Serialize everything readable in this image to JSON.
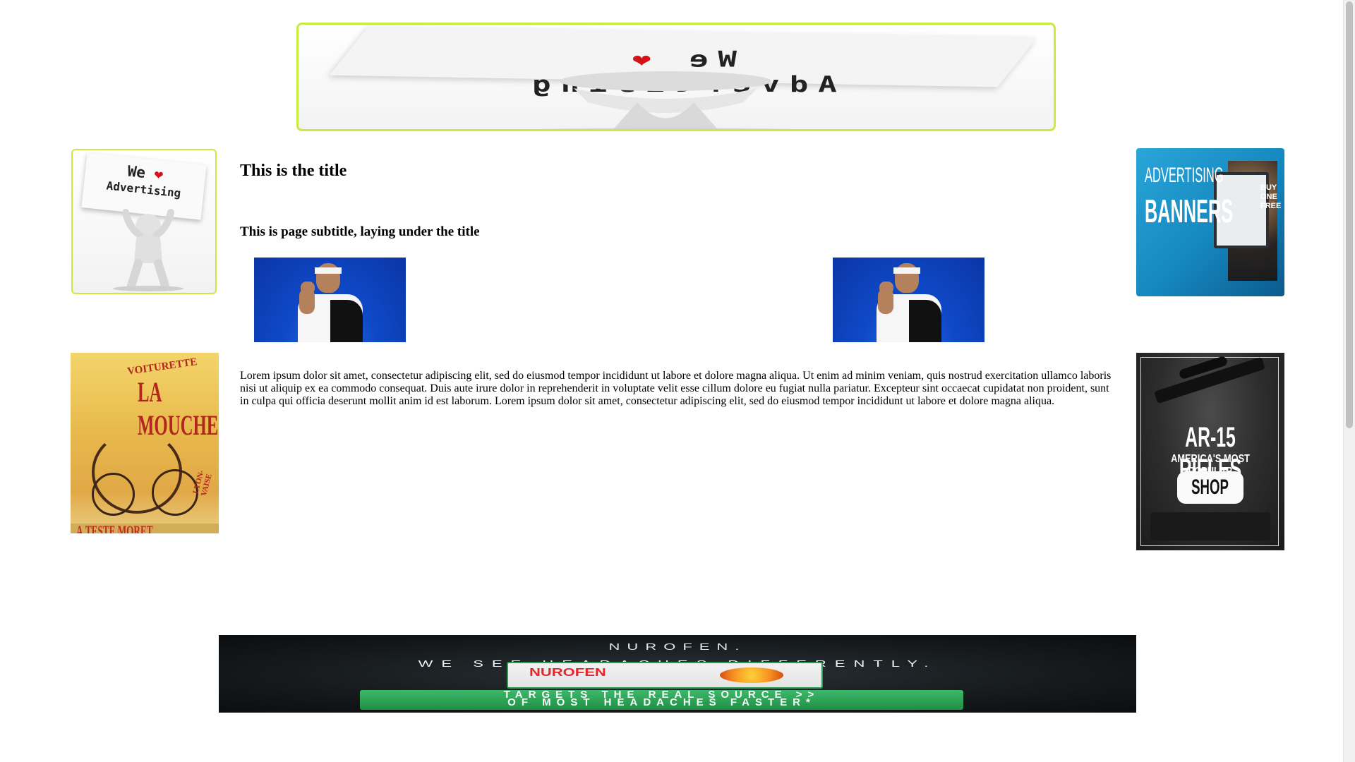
{
  "page": {
    "title": "This is the title",
    "subtitle": "This is page subtitle, laying under the title",
    "body_text": "Lorem ipsum dolor sit amet, consectetur adipiscing elit, sed do eiusmod tempor incididunt ut labore et dolore magna aliqua. Ut enim ad minim veniam, quis nostrud exercitation ullamco laboris nisi ut aliquip ex ea commodo consequat. Duis aute irure dolor in reprehenderit in voluptate velit esse cillum dolore eu fugiat nulla pariatur. Excepteur sint occaecat cupidatat non proident, sunt in culpa qui officia deserunt mollit anim id est laborum. Lorem ipsum dolor sit amet, consectetur adipiscing elit, sed do eiusmod tempor incididunt ut labore et dolore magna aliqua."
  },
  "ads": {
    "top_banner": {
      "line1": "We",
      "heart": "❤",
      "line2": "Advertising"
    },
    "left_top": {
      "line1": "We",
      "heart": "❤",
      "line2": "Advertising"
    },
    "right_top": {
      "line1": "ADVERTISING",
      "line2": "BANNERS",
      "offer": "BUY ONE FREE"
    },
    "left_bottom": {
      "line1": "VOITURETTE",
      "line2": "LA MOUCHE",
      "line3": "A.TESTE MORET, C.",
      "line4": "LYON-VAISE"
    },
    "right_bottom": {
      "line1": "AR-15 RIFLES",
      "line2": "AMERICA'S MOST POPULAR",
      "button": "SHOP"
    },
    "bottom_banner": {
      "brand": "NUROFEN.",
      "tagline": "WE SEE HEADACHES DIFFERENTLY.",
      "product": "NUROFEN",
      "cta_line1": "TARGETS THE REAL SOURCE >>",
      "cta_line2": "OF MOST HEADACHES FASTER*"
    }
  },
  "images": {
    "player_left": "tennis-player-photo",
    "player_right": "tennis-player-photo"
  },
  "colors": {
    "ad_border": "#c7ec3f",
    "heart": "#d2141a",
    "player_bg": "#0f49c8"
  }
}
